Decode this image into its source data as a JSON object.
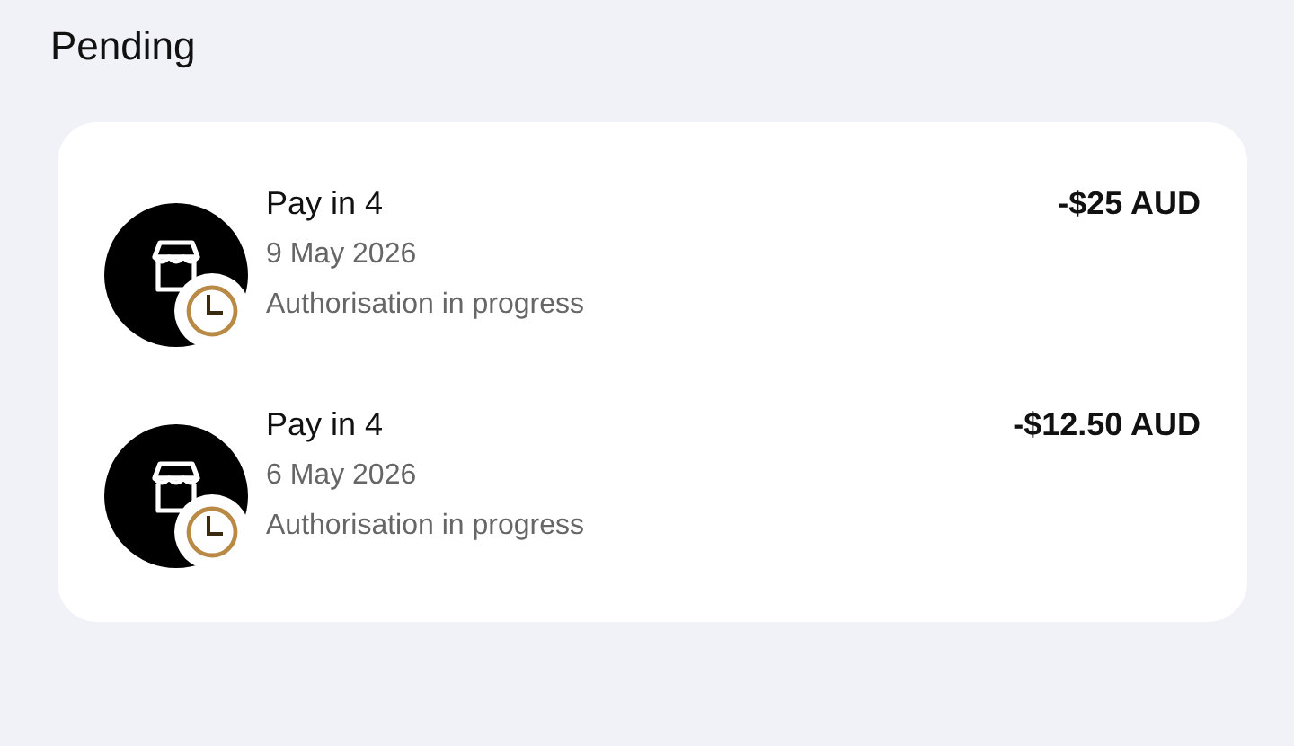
{
  "sections": [
    {
      "heading": "Pending",
      "transactions": [
        {
          "title": "Pay in 4",
          "date": "9 May 2026",
          "status": "Authorisation in progress",
          "amount": "-$25 AUD"
        },
        {
          "title": "Pay in 4",
          "date": "6 May 2026",
          "status": "Authorisation in progress",
          "amount": "-$12.50 AUD"
        }
      ]
    }
  ]
}
